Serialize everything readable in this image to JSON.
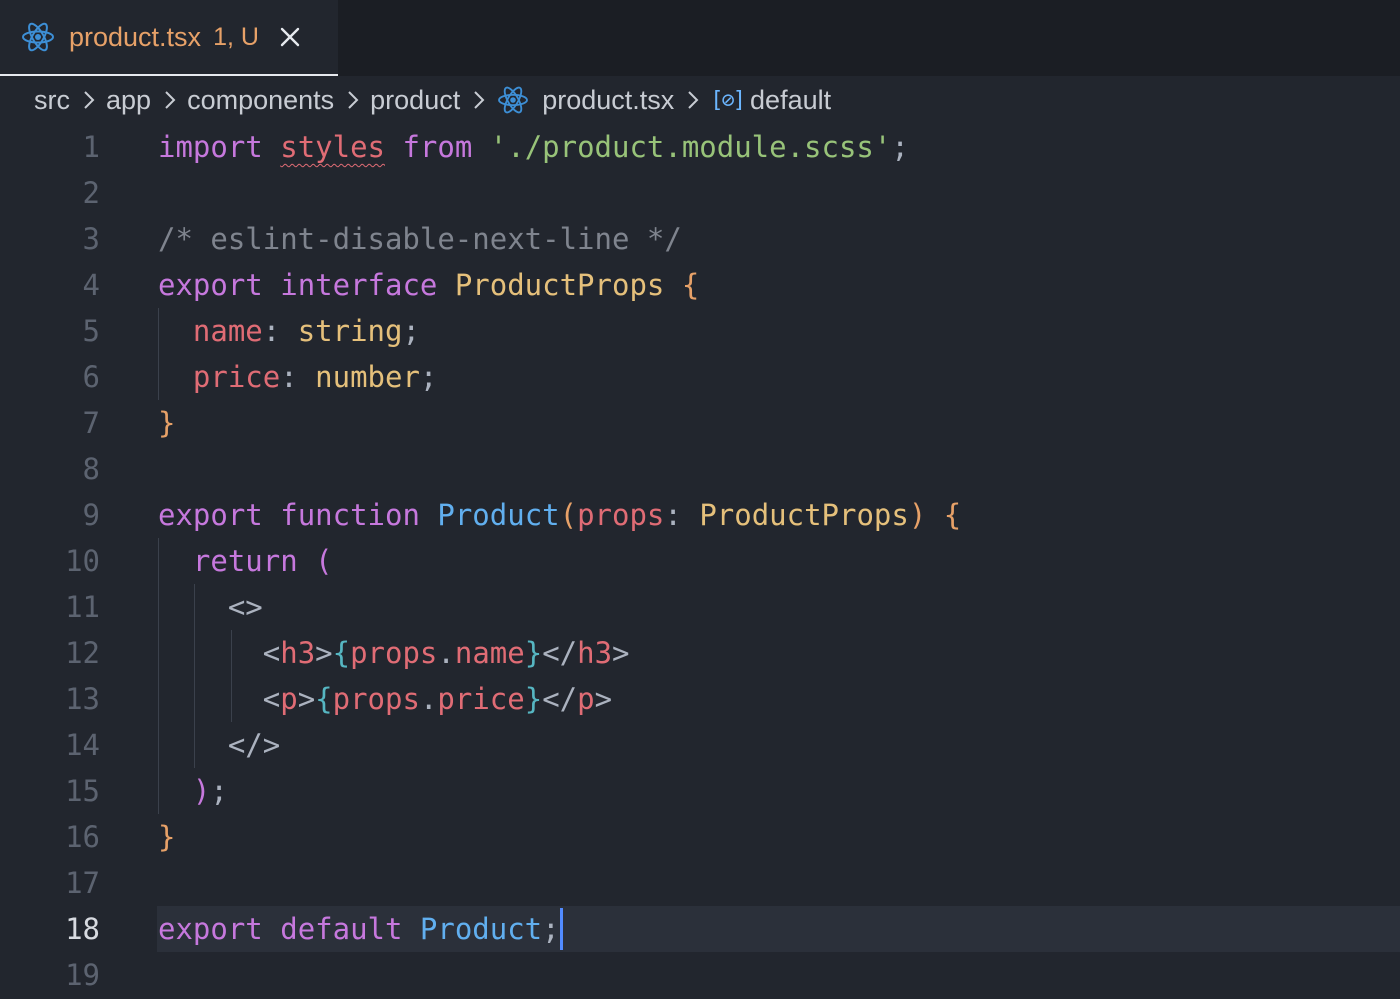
{
  "tab": {
    "icon": "react-icon",
    "filename": "product.tsx",
    "status": "1, U",
    "close_icon": "close-icon",
    "accent": "#e7a168"
  },
  "breadcrumb": {
    "items": [
      "src",
      "app",
      "components",
      "product"
    ],
    "file": "product.tsx",
    "symbol_icon": "[⊘]",
    "symbol": "default"
  },
  "editor": {
    "active_line": 18,
    "line_numbers": [
      "1",
      "2",
      "3",
      "4",
      "5",
      "6",
      "7",
      "8",
      "9",
      "10",
      "11",
      "12",
      "13",
      "14",
      "15",
      "16",
      "17",
      "18",
      "19"
    ],
    "lines": [
      [
        {
          "t": "import",
          "c": "kw"
        },
        {
          "t": " ",
          "c": "pu"
        },
        {
          "t": "styles",
          "c": "pr sq"
        },
        {
          "t": " ",
          "c": "pu"
        },
        {
          "t": "from",
          "c": "kw"
        },
        {
          "t": " ",
          "c": "pu"
        },
        {
          "t": "'./product.module.scss'",
          "c": "str"
        },
        {
          "t": ";",
          "c": "pu"
        }
      ],
      [],
      [
        {
          "t": "/* eslint-disable-next-line */",
          "c": "cm"
        }
      ],
      [
        {
          "t": "export",
          "c": "kw"
        },
        {
          "t": " ",
          "c": "pu"
        },
        {
          "t": "interface",
          "c": "kw"
        },
        {
          "t": " ",
          "c": "pu"
        },
        {
          "t": "ProductProps",
          "c": "ty"
        },
        {
          "t": " ",
          "c": "pu"
        },
        {
          "t": "{",
          "c": "br1"
        }
      ],
      [
        {
          "t": "  ",
          "c": "pu"
        },
        {
          "t": "name",
          "c": "pr"
        },
        {
          "t": ": ",
          "c": "pu"
        },
        {
          "t": "string",
          "c": "ty"
        },
        {
          "t": ";",
          "c": "pu"
        }
      ],
      [
        {
          "t": "  ",
          "c": "pu"
        },
        {
          "t": "price",
          "c": "pr"
        },
        {
          "t": ": ",
          "c": "pu"
        },
        {
          "t": "number",
          "c": "ty"
        },
        {
          "t": ";",
          "c": "pu"
        }
      ],
      [
        {
          "t": "}",
          "c": "br1"
        }
      ],
      [],
      [
        {
          "t": "export",
          "c": "kw"
        },
        {
          "t": " ",
          "c": "pu"
        },
        {
          "t": "function",
          "c": "kw"
        },
        {
          "t": " ",
          "c": "pu"
        },
        {
          "t": "Product",
          "c": "fn"
        },
        {
          "t": "(",
          "c": "br1"
        },
        {
          "t": "props",
          "c": "pr"
        },
        {
          "t": ": ",
          "c": "pu"
        },
        {
          "t": "ProductProps",
          "c": "ty"
        },
        {
          "t": ")",
          "c": "br1"
        },
        {
          "t": " ",
          "c": "pu"
        },
        {
          "t": "{",
          "c": "br1"
        }
      ],
      [
        {
          "t": "  ",
          "c": "pu"
        },
        {
          "t": "return",
          "c": "kw"
        },
        {
          "t": " ",
          "c": "pu"
        },
        {
          "t": "(",
          "c": "br2"
        }
      ],
      [
        {
          "t": "    ",
          "c": "pu"
        },
        {
          "t": "<>",
          "c": "pu"
        }
      ],
      [
        {
          "t": "      ",
          "c": "pu"
        },
        {
          "t": "<",
          "c": "pu"
        },
        {
          "t": "h3",
          "c": "tag"
        },
        {
          "t": ">",
          "c": "pu"
        },
        {
          "t": "{",
          "c": "br3"
        },
        {
          "t": "props",
          "c": "pr"
        },
        {
          "t": ".",
          "c": "pu"
        },
        {
          "t": "name",
          "c": "pr"
        },
        {
          "t": "}",
          "c": "br3"
        },
        {
          "t": "</",
          "c": "pu"
        },
        {
          "t": "h3",
          "c": "tag"
        },
        {
          "t": ">",
          "c": "pu"
        }
      ],
      [
        {
          "t": "      ",
          "c": "pu"
        },
        {
          "t": "<",
          "c": "pu"
        },
        {
          "t": "p",
          "c": "tag"
        },
        {
          "t": ">",
          "c": "pu"
        },
        {
          "t": "{",
          "c": "br3"
        },
        {
          "t": "props",
          "c": "pr"
        },
        {
          "t": ".",
          "c": "pu"
        },
        {
          "t": "price",
          "c": "pr"
        },
        {
          "t": "}",
          "c": "br3"
        },
        {
          "t": "</",
          "c": "pu"
        },
        {
          "t": "p",
          "c": "tag"
        },
        {
          "t": ">",
          "c": "pu"
        }
      ],
      [
        {
          "t": "    ",
          "c": "pu"
        },
        {
          "t": "</>",
          "c": "pu"
        }
      ],
      [
        {
          "t": "  ",
          "c": "pu"
        },
        {
          "t": ")",
          "c": "br2"
        },
        {
          "t": ";",
          "c": "pu"
        }
      ],
      [
        {
          "t": "}",
          "c": "br1"
        }
      ],
      [],
      [
        {
          "t": "export",
          "c": "kw"
        },
        {
          "t": " ",
          "c": "pu"
        },
        {
          "t": "default",
          "c": "kw"
        },
        {
          "t": " ",
          "c": "pu"
        },
        {
          "t": "Product",
          "c": "fn"
        },
        {
          "t": ";",
          "c": "pu"
        }
      ],
      []
    ]
  }
}
